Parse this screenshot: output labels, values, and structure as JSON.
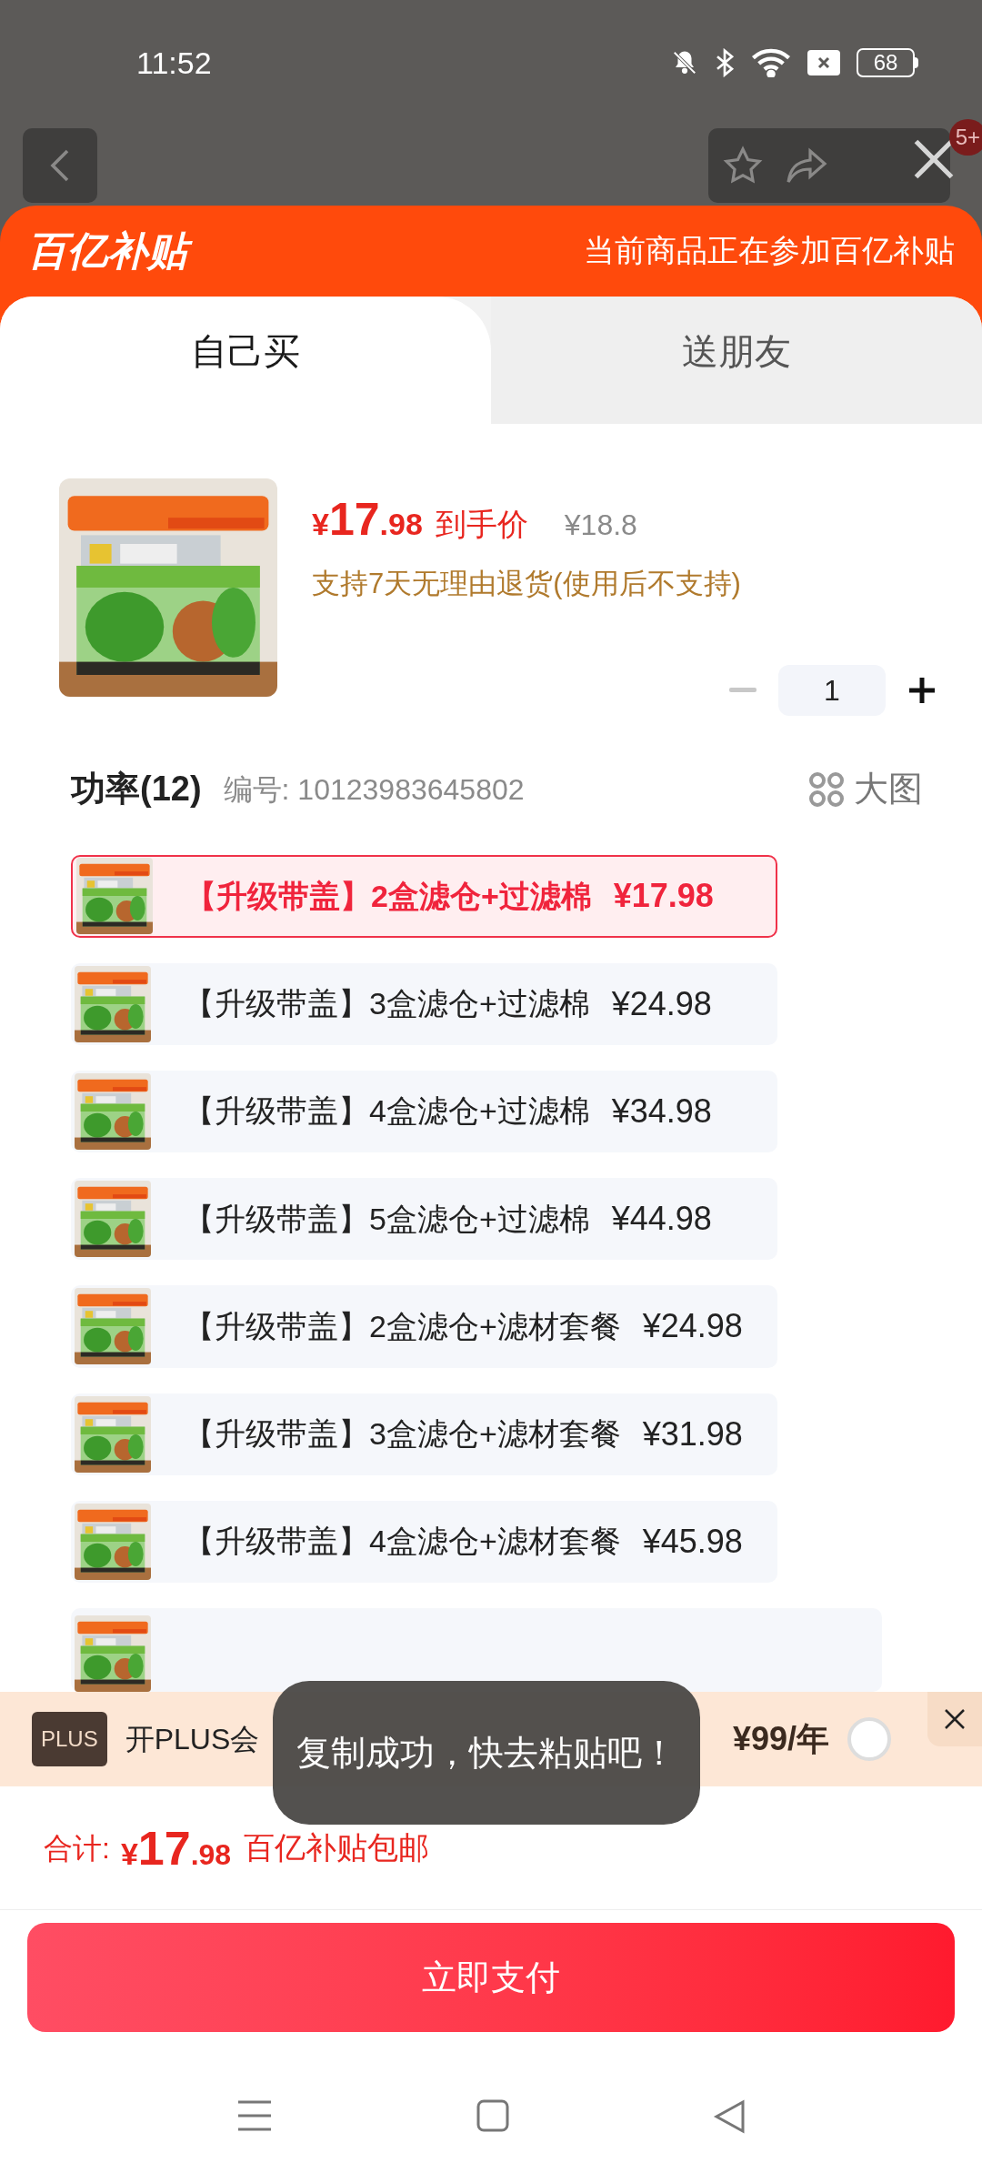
{
  "status_bar": {
    "time": "11:52",
    "battery": "68"
  },
  "top_nav": {
    "badge": "5+"
  },
  "banner": {
    "logo": "百亿补贴",
    "notice": "当前商品正在参加百亿补贴"
  },
  "tabs": [
    {
      "label": "自己买",
      "selected": true
    },
    {
      "label": "送朋友",
      "selected": false
    }
  ],
  "product": {
    "price": {
      "currency": "¥",
      "integer": "17",
      "decimal": ".98"
    },
    "price_label": "到手价",
    "original_price": "¥18.8",
    "return_policy": "支持7天无理由退货(使用后不支持)",
    "quantity": "1"
  },
  "spec": {
    "title": "功率(12)",
    "code": "编号: 10123983645802",
    "view_large": "大图"
  },
  "options": [
    {
      "label": "【升级带盖】2盒滤仓+过滤棉",
      "price": "¥17.98",
      "selected": true
    },
    {
      "label": "【升级带盖】3盒滤仓+过滤棉",
      "price": "¥24.98",
      "selected": false
    },
    {
      "label": "【升级带盖】4盒滤仓+过滤棉",
      "price": "¥34.98",
      "selected": false
    },
    {
      "label": "【升级带盖】5盒滤仓+过滤棉",
      "price": "¥44.98",
      "selected": false
    },
    {
      "label": "【升级带盖】2盒滤仓+滤材套餐",
      "price": "¥24.98",
      "selected": false
    },
    {
      "label": "【升级带盖】3盒滤仓+滤材套餐",
      "price": "¥31.98",
      "selected": false
    },
    {
      "label": "【升级带盖】4盒滤仓+滤材套餐",
      "price": "¥45.98",
      "selected": false
    }
  ],
  "plus_bar": {
    "badge": "PLUS",
    "text": "开PLUS会",
    "price": "¥99/年",
    "selected": false
  },
  "toast": "复制成功，快去粘贴吧！",
  "total": {
    "label": "合计:",
    "currency": "¥",
    "integer": "17",
    "decimal": ".98",
    "note": "百亿补贴包邮"
  },
  "pay_button": "立即支付"
}
